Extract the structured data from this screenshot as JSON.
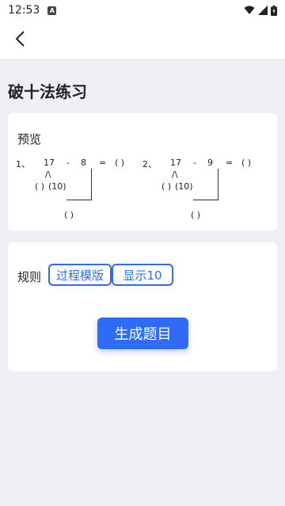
{
  "status_bar": {
    "time": "12:53",
    "notification_icon": "A"
  },
  "page": {
    "title": "破十法练习"
  },
  "preview": {
    "label": "预览",
    "problems": [
      {
        "index": "1、",
        "minuend": "17",
        "operator": "-",
        "subtrahend": "8",
        "equals": "=",
        "answer_blank": "(  )",
        "split_mark": "/\\",
        "split_left": "(  )",
        "split_right": "(10)",
        "bottom_blank": "(  )"
      },
      {
        "index": "2、",
        "minuend": "17",
        "operator": "-",
        "subtrahend": "9",
        "equals": "=",
        "answer_blank": "(  )",
        "split_mark": "/\\",
        "split_left": "(  )",
        "split_right": "(10)",
        "bottom_blank": "(  )"
      }
    ]
  },
  "rules": {
    "label": "规则",
    "chips": [
      {
        "label": "过程模版"
      },
      {
        "label": "显示10"
      }
    ],
    "generate_label": "生成题目"
  },
  "colors": {
    "accent": "#2f6cf6",
    "background": "#eef0f6"
  }
}
